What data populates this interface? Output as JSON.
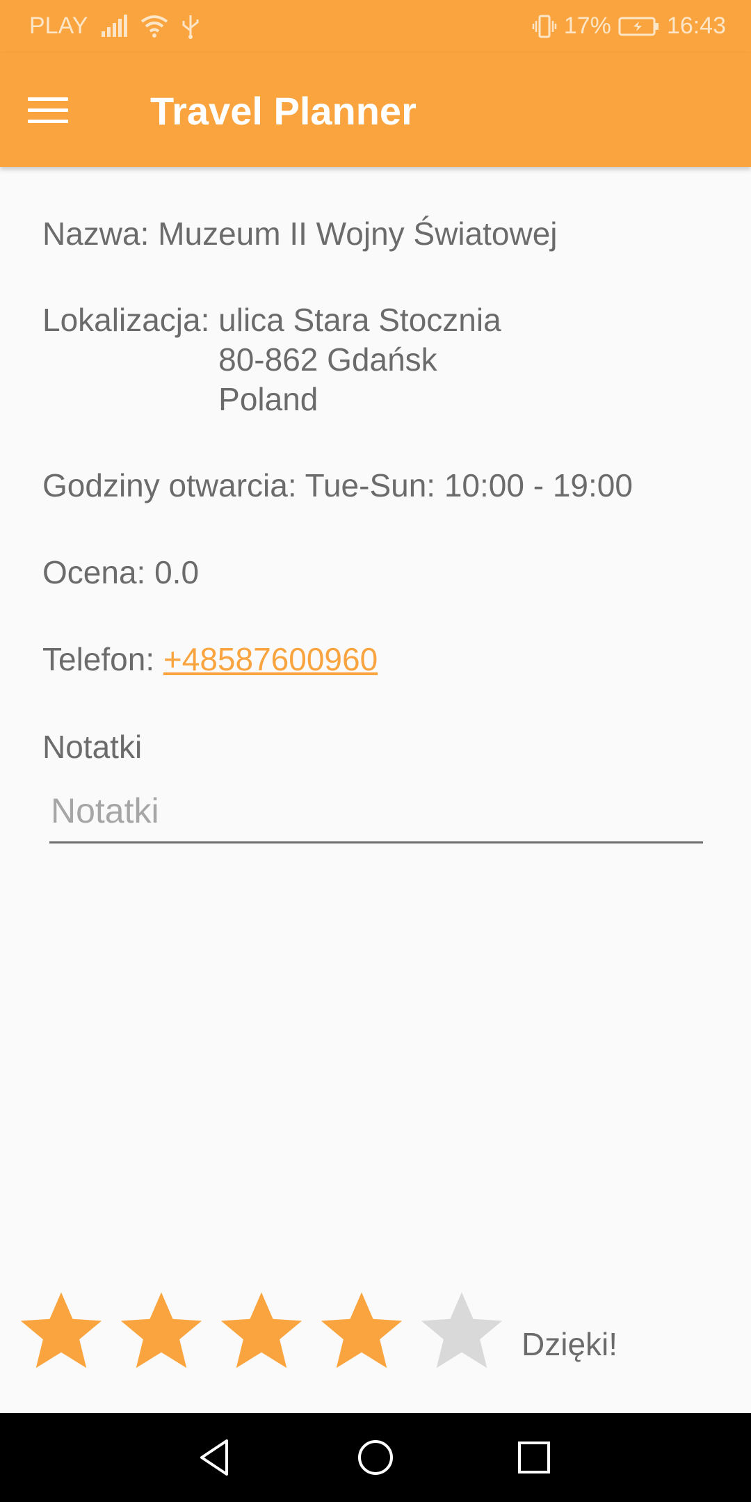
{
  "status_bar": {
    "carrier": "PLAY",
    "battery_percent": "17%",
    "time": "16:43",
    "icons": [
      "signal-icon",
      "wifi-icon",
      "usb-icon",
      "vibrate-icon",
      "battery-icon"
    ]
  },
  "app_bar": {
    "title": "Travel Planner",
    "menu_icon": "hamburger-menu-icon"
  },
  "details": {
    "name_label": "Nazwa:",
    "name_value": "Muzeum II Wojny Światowej",
    "location_label": "Lokalizacja:",
    "location_lines": [
      "ulica Stara Stocznia",
      "80-862 Gdańsk",
      "Poland"
    ],
    "hours_label": "Godziny otwarcia:",
    "hours_value": "Tue-Sun: 10:00 - 19:00",
    "rating_label": "Ocena:",
    "rating_value": "0.0",
    "phone_label": "Telefon:",
    "phone_value": "+48587600960"
  },
  "notes": {
    "label": "Notatki",
    "placeholder": "Notatki",
    "value": ""
  },
  "rating_bar": {
    "max_stars": 5,
    "selected_stars": 4,
    "thanks_text": "Dzięki!"
  },
  "colors": {
    "accent": "#f9a43f",
    "text": "#6b6b6b",
    "star_filled": "#f9a43f",
    "star_empty": "#d9d9d9"
  },
  "nav_bar": {
    "buttons": [
      "back-icon",
      "home-icon",
      "recents-icon"
    ]
  }
}
